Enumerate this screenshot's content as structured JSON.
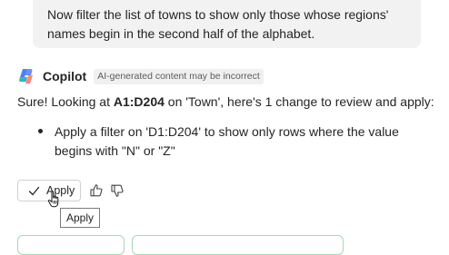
{
  "user_message": {
    "text": "Now filter the list of towns to show only those whose regions' names begin in the second half of the alphabet."
  },
  "copilot": {
    "name": "Copilot",
    "badge": "AI-generated content may be incorrect",
    "response_prefix": "Sure! Looking at ",
    "response_range": "A1:D204",
    "response_suffix": " on 'Town', here's 1 change to review and apply:",
    "bullets": [
      "Apply a filter on 'D1:D204' to show only rows where the value begins with \"N\" or \"Z\""
    ]
  },
  "actions": {
    "apply_label": "Apply",
    "tooltip": "Apply"
  },
  "icons": [
    "copilot-logo",
    "check-icon",
    "thumb-up-icon",
    "thumb-down-icon",
    "hand-cursor-icon"
  ],
  "colors": {
    "bubble_bg": "#f2f2f2",
    "text": "#242424",
    "card_border": "#a6d8b8"
  }
}
